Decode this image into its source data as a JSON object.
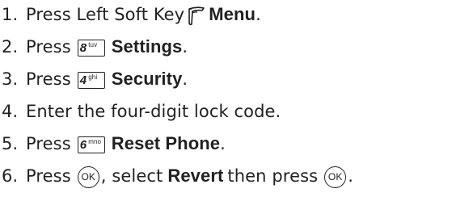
{
  "steps": [
    {
      "number": "1.",
      "before": "Press Left Soft Key",
      "icon": "left-soft-key-icon",
      "bold": "Menu",
      "after": "."
    },
    {
      "number": "2.",
      "before": "Press",
      "key": {
        "digit": "8",
        "letters": "tuv"
      },
      "bold": "Settings",
      "after": "."
    },
    {
      "number": "3.",
      "before": "Press",
      "key": {
        "digit": "4",
        "letters": "ghi"
      },
      "bold": "Security",
      "after": "."
    },
    {
      "number": "4.",
      "text": "Enter the four-digit lock code."
    },
    {
      "number": "5.",
      "before": "Press",
      "key": {
        "digit": "6",
        "letters": "mno"
      },
      "bold": "Reset Phone",
      "after": "."
    },
    {
      "number": "6.",
      "before": "Press",
      "ok_label": "OK",
      "middle": ", select",
      "bold": "Revert",
      "middle2": "then press",
      "after": "."
    }
  ]
}
